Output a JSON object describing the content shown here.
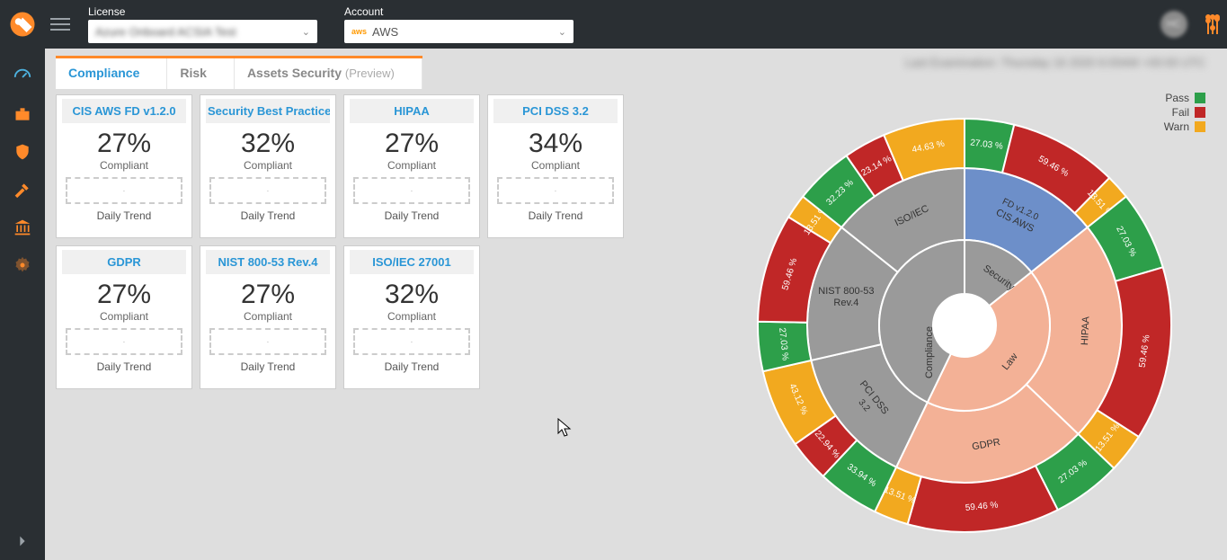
{
  "header": {
    "license": {
      "label": "License",
      "value": "Azure Onboard ACSIA Test"
    },
    "account": {
      "label": "Account",
      "value": "AWS",
      "provider": "aws"
    }
  },
  "tabs": [
    {
      "id": "compliance",
      "label": "Compliance",
      "active": true
    },
    {
      "id": "risk",
      "label": "Risk",
      "active": false
    },
    {
      "id": "assets",
      "label": "Assets Security",
      "preview": "(Preview)",
      "active": false
    }
  ],
  "status_line": "Last Examination: Thursday 16 2020 6:00AM +00:00 UTC",
  "cards": [
    {
      "title": "CIS AWS FD v1.2.0",
      "pct": "27%",
      "sub": "Compliant",
      "trend": "Daily Trend"
    },
    {
      "title": "Security Best Practices",
      "pct": "32%",
      "sub": "Compliant",
      "trend": "Daily Trend"
    },
    {
      "title": "HIPAA",
      "pct": "27%",
      "sub": "Compliant",
      "trend": "Daily Trend"
    },
    {
      "title": "PCI DSS 3.2",
      "pct": "34%",
      "sub": "Compliant",
      "trend": "Daily Trend"
    },
    {
      "title": "GDPR",
      "pct": "27%",
      "sub": "Compliant",
      "trend": "Daily Trend"
    },
    {
      "title": "NIST 800-53 Rev.4",
      "pct": "27%",
      "sub": "Compliant",
      "trend": "Daily Trend"
    },
    {
      "title": "ISO/IEC 27001",
      "pct": "32%",
      "sub": "Compliant",
      "trend": "Daily Trend"
    }
  ],
  "legend": {
    "pass": "Pass",
    "fail": "Fail",
    "warn": "Warn"
  },
  "chart_data": {
    "type": "sunburst",
    "center": "Compliance",
    "level1": [
      {
        "name": "Security",
        "color": "#9a9a9a"
      },
      {
        "name": "Law",
        "color": "#9a9a9a"
      }
    ],
    "level2": [
      {
        "name": "CIS AWS FD v1.2.0",
        "parent": "Security",
        "weight": 1,
        "color": "#6d8fc9"
      },
      {
        "name": "ISO/IEC",
        "parent": "Security",
        "weight": 1,
        "color": "#9a9a9a"
      },
      {
        "name": "NIST 800-53 Rev.4",
        "parent": "Security",
        "weight": 1,
        "color": "#9a9a9a"
      },
      {
        "name": "PCI DSS 3.2",
        "parent": "Security",
        "weight": 1,
        "color": "#9a9a9a"
      },
      {
        "name": "HIPAA",
        "parent": "Law",
        "weight": 1.6,
        "color": "#f3b196"
      },
      {
        "name": "GDPR",
        "parent": "Law",
        "weight": 1.4,
        "color": "#f3b196"
      }
    ],
    "level3_template": {
      "pass_color": "#2d9f4a",
      "fail_color": "#c02727",
      "warn_color": "#f2a91f"
    },
    "level3": {
      "CIS AWS FD v1.2.0": [
        {
          "k": "pass",
          "v": 27.03
        },
        {
          "k": "fail",
          "v": 59.46
        },
        {
          "k": "warn",
          "v": 13.51
        }
      ],
      "HIPAA": [
        {
          "k": "pass",
          "v": 27.03
        },
        {
          "k": "fail",
          "v": 59.46
        },
        {
          "k": "warn",
          "v": 13.51
        }
      ],
      "GDPR": [
        {
          "k": "pass",
          "v": 27.03
        },
        {
          "k": "fail",
          "v": 59.46
        },
        {
          "k": "warn",
          "v": 13.51
        }
      ],
      "PCI DSS 3.2": [
        {
          "k": "pass",
          "v": 33.94
        },
        {
          "k": "fail",
          "v": 22.94
        },
        {
          "k": "warn",
          "v": 43.12
        }
      ],
      "NIST 800-53 Rev.4": [
        {
          "k": "pass",
          "v": 27.03
        },
        {
          "k": "fail",
          "v": 59.46
        },
        {
          "k": "warn",
          "v": 13.51
        }
      ],
      "ISO/IEC": [
        {
          "k": "pass",
          "v": 32.23
        },
        {
          "k": "fail",
          "v": 23.14
        },
        {
          "k": "warn",
          "v": 44.63
        }
      ]
    }
  }
}
